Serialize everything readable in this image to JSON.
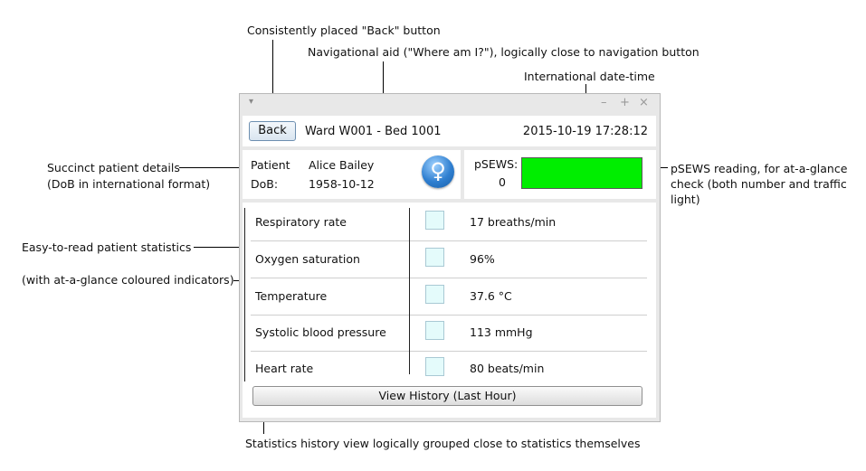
{
  "annotations": {
    "back_button": "Consistently placed \"Back\" button",
    "nav_aid": "Navigational aid (\"Where am I?\"), logically close to navigation button",
    "date_time": "International date-time",
    "patient_details_line1": "Succinct patient details",
    "patient_details_line2": "(DoB in international format)",
    "psews_reading": "pSEWS reading, for at-a-glance check (both number and traffic light)",
    "stats": "Easy-to-read patient statistics",
    "indicators": "(with at-a-glance coloured indicators)",
    "history": "Statistics history view logically grouped close to statistics themselves"
  },
  "window": {
    "controls": {
      "menu": "▾",
      "minimize": "–",
      "maximize": "+",
      "close": "×"
    }
  },
  "header": {
    "back_label": "Back",
    "location": "Ward  W001  - Bed  1001",
    "datetime": "2015-10-19 17:28:12"
  },
  "patient": {
    "name_label": "Patient",
    "name": "Alice Bailey",
    "dob_label": "DoB:",
    "dob": "1958-10-12",
    "gender_icon": "female-symbol-icon"
  },
  "psews": {
    "label": "pSEWS:",
    "value": "0",
    "status_color": "#00ee00"
  },
  "stats": [
    {
      "label": "Respiratory rate",
      "value": "17 breaths/min"
    },
    {
      "label": "Oxygen saturation",
      "value": "96%"
    },
    {
      "label": "Temperature",
      "value": "37.6 °C"
    },
    {
      "label": "Systolic blood pressure",
      "value": "113 mmHg"
    },
    {
      "label": "Heart rate",
      "value": "80 beats/min"
    }
  ],
  "history_button": "View History (Last Hour)"
}
